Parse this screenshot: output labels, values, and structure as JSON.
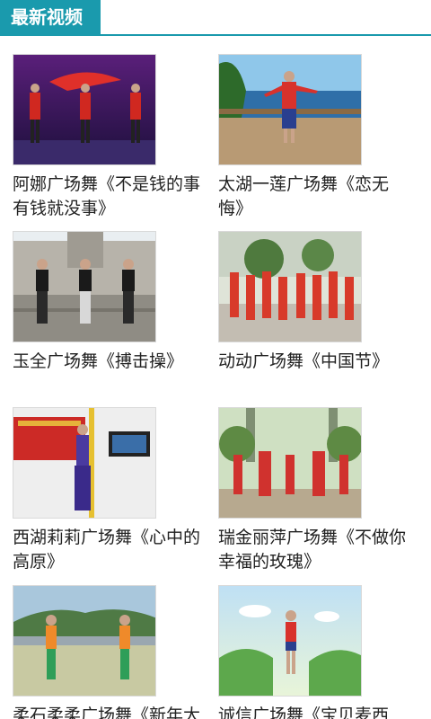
{
  "header": {
    "title": "最新视频",
    "accent_color": "#1a9aad"
  },
  "videos": [
    {
      "title": "阿娜广场舞《不是钱的事有钱就没事》"
    },
    {
      "title": "太湖一莲广场舞《恋无悔》"
    },
    {
      "title": "玉全广场舞《搏击操》"
    },
    {
      "title": "动动广场舞《中国节》"
    },
    {
      "title": "西湖莉莉广场舞《心中的高原》"
    },
    {
      "title": "瑞金丽萍广场舞《不做你幸福的玫瑰》"
    },
    {
      "title": "柔石柔柔广场舞《新年大"
    },
    {
      "title": "诚信广场舞《宝贝麦西"
    }
  ]
}
